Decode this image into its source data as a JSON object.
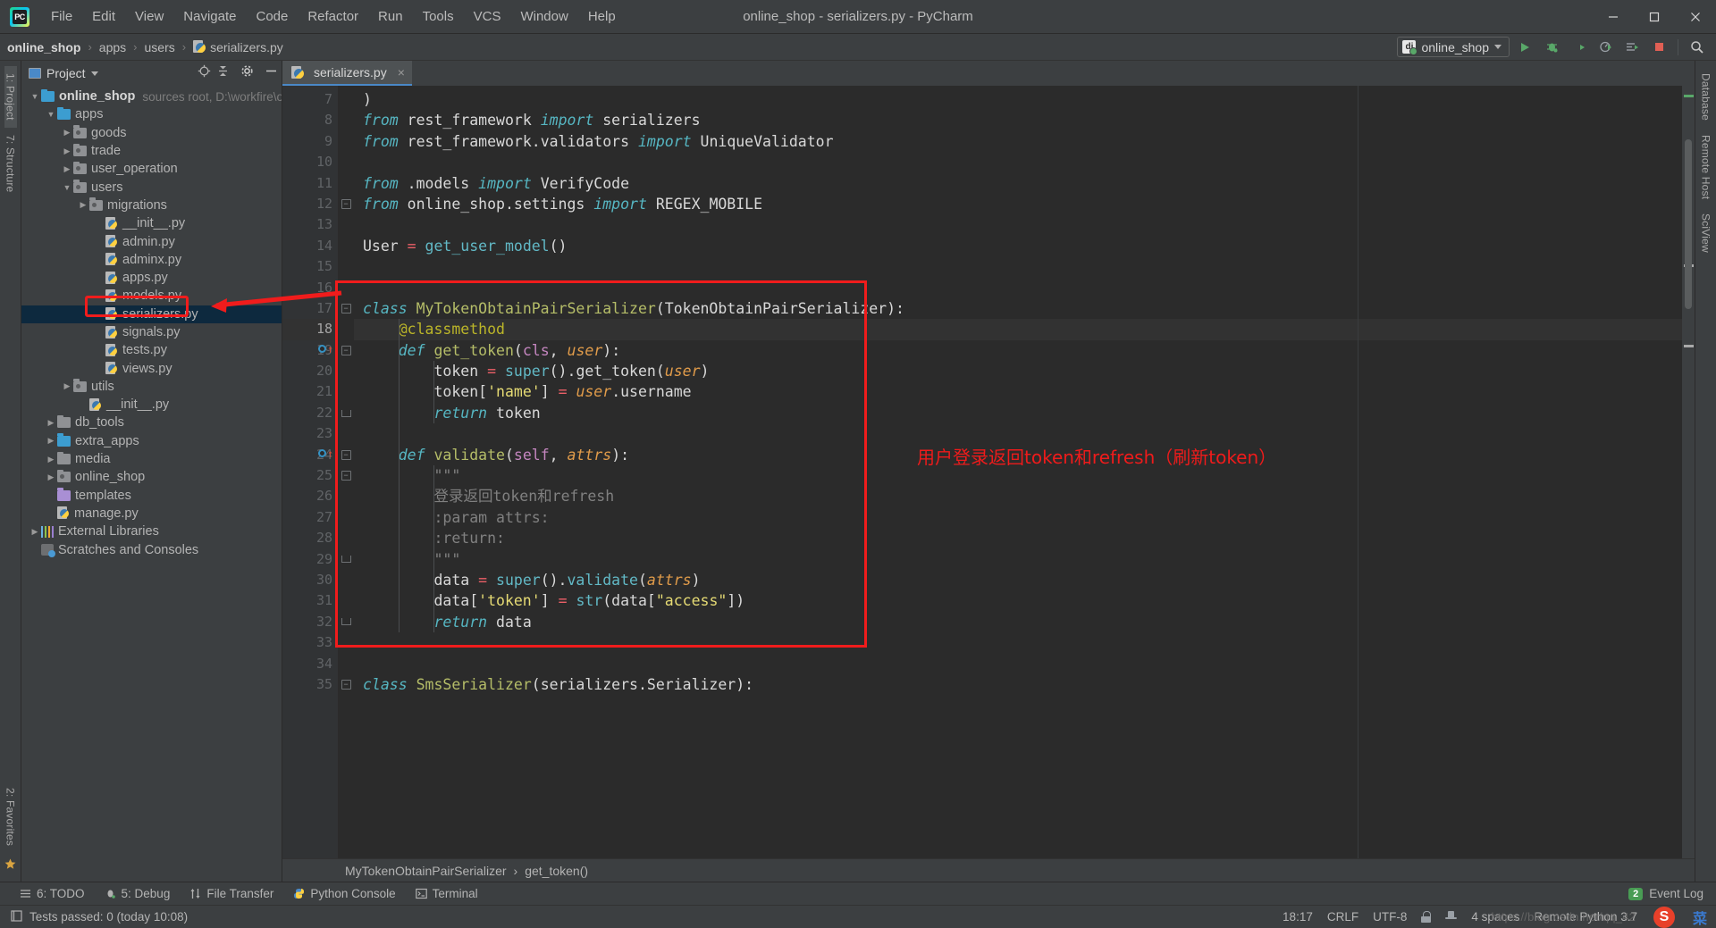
{
  "window": {
    "title": "online_shop - serializers.py - PyCharm",
    "logo_text": "PC",
    "minimize_label": "Minimize",
    "maximize_label": "Maximize",
    "close_label": "Close"
  },
  "menubar": {
    "items": [
      "File",
      "Edit",
      "View",
      "Navigate",
      "Code",
      "Refactor",
      "Run",
      "Tools",
      "VCS",
      "Window",
      "Help"
    ]
  },
  "breadcrumb": {
    "items": [
      "online_shop",
      "apps",
      "users",
      "serializers.py"
    ],
    "separator": "›"
  },
  "toolbar": {
    "run_config": "online_shop",
    "run_config_icon": "django-icon",
    "buttons": [
      {
        "name": "run-button",
        "glyph": "▶"
      },
      {
        "name": "debug-button",
        "glyph": "🐞"
      },
      {
        "name": "coverage-button",
        "glyph": "◑"
      },
      {
        "name": "profile-button",
        "glyph": "◴"
      },
      {
        "name": "attach-button",
        "glyph": "☰"
      },
      {
        "name": "stop-button",
        "glyph": "■"
      },
      {
        "name": "search-everywhere-button",
        "glyph": "🔍"
      }
    ]
  },
  "left_strip": {
    "items": [
      {
        "label": "1: Project",
        "selected": true
      },
      {
        "label": "7: Structure",
        "selected": false
      }
    ],
    "bottom_items": [
      {
        "label": "2: Favorites",
        "selected": false
      }
    ]
  },
  "right_strip": {
    "items": [
      {
        "label": "Database",
        "selected": false
      },
      {
        "label": "Remote Host",
        "selected": false
      },
      {
        "label": "SciView",
        "selected": false
      }
    ]
  },
  "project_panel": {
    "title": "Project",
    "icons": [
      "locate-icon",
      "collapse-all-icon",
      "settings-gear-icon",
      "hide-icon"
    ],
    "tree": [
      {
        "depth": 0,
        "arrow": "down",
        "icon": "folder-source",
        "label": "online_shop",
        "bold": true,
        "note": "sources root,  D:\\workfire\\onl"
      },
      {
        "depth": 1,
        "arrow": "down",
        "icon": "folder-source",
        "label": "apps",
        "bold": false,
        "note": ""
      },
      {
        "depth": 2,
        "arrow": "right",
        "icon": "folder-module",
        "label": "goods",
        "bold": false,
        "note": ""
      },
      {
        "depth": 2,
        "arrow": "right",
        "icon": "folder-module",
        "label": "trade",
        "bold": false,
        "note": ""
      },
      {
        "depth": 2,
        "arrow": "right",
        "icon": "folder-module",
        "label": "user_operation",
        "bold": false,
        "note": ""
      },
      {
        "depth": 2,
        "arrow": "down",
        "icon": "folder-module",
        "label": "users",
        "bold": false,
        "note": ""
      },
      {
        "depth": 3,
        "arrow": "right",
        "icon": "folder-module",
        "label": "migrations",
        "bold": false,
        "note": ""
      },
      {
        "depth": 4,
        "arrow": "none",
        "icon": "python-file",
        "label": "__init__.py",
        "bold": false,
        "note": ""
      },
      {
        "depth": 4,
        "arrow": "none",
        "icon": "python-file",
        "label": "admin.py",
        "bold": false,
        "note": ""
      },
      {
        "depth": 4,
        "arrow": "none",
        "icon": "python-file",
        "label": "adminx.py",
        "bold": false,
        "note": ""
      },
      {
        "depth": 4,
        "arrow": "none",
        "icon": "python-file",
        "label": "apps.py",
        "bold": false,
        "note": ""
      },
      {
        "depth": 4,
        "arrow": "none",
        "icon": "python-file",
        "label": "models.py",
        "bold": false,
        "note": ""
      },
      {
        "depth": 4,
        "arrow": "none",
        "icon": "python-file",
        "label": "serializers.py",
        "bold": false,
        "note": "",
        "selected": true
      },
      {
        "depth": 4,
        "arrow": "none",
        "icon": "python-file",
        "label": "signals.py",
        "bold": false,
        "note": ""
      },
      {
        "depth": 4,
        "arrow": "none",
        "icon": "python-file",
        "label": "tests.py",
        "bold": false,
        "note": ""
      },
      {
        "depth": 4,
        "arrow": "none",
        "icon": "python-file",
        "label": "views.py",
        "bold": false,
        "note": ""
      },
      {
        "depth": 2,
        "arrow": "right",
        "icon": "folder-module",
        "label": "utils",
        "bold": false,
        "note": ""
      },
      {
        "depth": 3,
        "arrow": "none",
        "icon": "python-file",
        "label": "__init__.py",
        "bold": false,
        "note": ""
      },
      {
        "depth": 1,
        "arrow": "right",
        "icon": "folder",
        "label": "db_tools",
        "bold": false,
        "note": ""
      },
      {
        "depth": 1,
        "arrow": "right",
        "icon": "folder-source",
        "label": "extra_apps",
        "bold": false,
        "note": ""
      },
      {
        "depth": 1,
        "arrow": "right",
        "icon": "folder",
        "label": "media",
        "bold": false,
        "note": ""
      },
      {
        "depth": 1,
        "arrow": "right",
        "icon": "folder-module",
        "label": "online_shop",
        "bold": false,
        "note": ""
      },
      {
        "depth": 1,
        "arrow": "none",
        "icon": "folder-template",
        "label": "templates",
        "bold": false,
        "note": ""
      },
      {
        "depth": 1,
        "arrow": "none",
        "icon": "python-file",
        "label": "manage.py",
        "bold": false,
        "note": ""
      },
      {
        "depth": 0,
        "arrow": "right",
        "icon": "external-libraries",
        "label": "External Libraries",
        "bold": false,
        "note": ""
      },
      {
        "depth": 0,
        "arrow": "none",
        "icon": "scratches",
        "label": "Scratches and Consoles",
        "bold": false,
        "note": ""
      }
    ]
  },
  "editor": {
    "tab": {
      "label": "serializers.py",
      "icon": "python-file",
      "close": "×"
    },
    "first_line_number": 7,
    "current_line": 18,
    "lines": [
      {
        "n": 7,
        "tokens": [
          {
            "t": ")",
            "c": "plain"
          }
        ]
      },
      {
        "n": 8,
        "tokens": [
          {
            "t": "from",
            "c": "kwi"
          },
          {
            "t": " rest_framework ",
            "c": "plain"
          },
          {
            "t": "import",
            "c": "kwi"
          },
          {
            "t": " serializers",
            "c": "plain"
          }
        ]
      },
      {
        "n": 9,
        "tokens": [
          {
            "t": "from",
            "c": "kwi"
          },
          {
            "t": " rest_framework.validators ",
            "c": "plain"
          },
          {
            "t": "import",
            "c": "kwi"
          },
          {
            "t": " UniqueValidator",
            "c": "plain"
          }
        ]
      },
      {
        "n": 10,
        "tokens": []
      },
      {
        "n": 11,
        "tokens": [
          {
            "t": "from",
            "c": "kwi"
          },
          {
            "t": " .models ",
            "c": "plain"
          },
          {
            "t": "import",
            "c": "kwi"
          },
          {
            "t": " VerifyCode",
            "c": "plain"
          }
        ]
      },
      {
        "n": 12,
        "tokens": [
          {
            "t": "from",
            "c": "kwi"
          },
          {
            "t": " online_shop.settings ",
            "c": "plain"
          },
          {
            "t": "import",
            "c": "kwi"
          },
          {
            "t": " REGEX_MOBILE",
            "c": "plain"
          }
        ]
      },
      {
        "n": 13,
        "tokens": []
      },
      {
        "n": 14,
        "tokens": [
          {
            "t": "User ",
            "c": "plain"
          },
          {
            "t": "=",
            "c": "op"
          },
          {
            "t": " ",
            "c": "plain"
          },
          {
            "t": "get_user_model",
            "c": "call"
          },
          {
            "t": "()",
            "c": "plain"
          }
        ]
      },
      {
        "n": 15,
        "tokens": []
      },
      {
        "n": 16,
        "tokens": []
      },
      {
        "n": 17,
        "tokens": [
          {
            "t": "class",
            "c": "kwi"
          },
          {
            "t": " ",
            "c": "plain"
          },
          {
            "t": "MyTokenObtainPairSerializer",
            "c": "fn"
          },
          {
            "t": "(",
            "c": "plain"
          },
          {
            "t": "TokenObtainPairSerializer",
            "c": "plain"
          },
          {
            "t": "):",
            "c": "plain"
          }
        ]
      },
      {
        "n": 18,
        "tokens": [
          {
            "t": "    ",
            "c": "plain"
          },
          {
            "t": "@classmethod",
            "c": "dec"
          }
        ]
      },
      {
        "n": 19,
        "tokens": [
          {
            "t": "    ",
            "c": "plain"
          },
          {
            "t": "def",
            "c": "kwi"
          },
          {
            "t": " ",
            "c": "plain"
          },
          {
            "t": "get_token",
            "c": "fn"
          },
          {
            "t": "(",
            "c": "plain"
          },
          {
            "t": "cls",
            "c": "slf"
          },
          {
            "t": ", ",
            "c": "plain"
          },
          {
            "t": "user",
            "c": "par"
          },
          {
            "t": "):",
            "c": "plain"
          }
        ]
      },
      {
        "n": 20,
        "tokens": [
          {
            "t": "        token ",
            "c": "plain"
          },
          {
            "t": "=",
            "c": "op"
          },
          {
            "t": " ",
            "c": "plain"
          },
          {
            "t": "super",
            "c": "call"
          },
          {
            "t": "().",
            "c": "plain"
          },
          {
            "t": "get_token",
            "c": "plain"
          },
          {
            "t": "(",
            "c": "plain"
          },
          {
            "t": "user",
            "c": "par"
          },
          {
            "t": ")",
            "c": "plain"
          }
        ]
      },
      {
        "n": 21,
        "tokens": [
          {
            "t": "        token[",
            "c": "plain"
          },
          {
            "t": "'name'",
            "c": "str"
          },
          {
            "t": "] ",
            "c": "plain"
          },
          {
            "t": "=",
            "c": "op"
          },
          {
            "t": " ",
            "c": "plain"
          },
          {
            "t": "user",
            "c": "par"
          },
          {
            "t": ".username",
            "c": "plain"
          }
        ]
      },
      {
        "n": 22,
        "tokens": [
          {
            "t": "        ",
            "c": "plain"
          },
          {
            "t": "return",
            "c": "kwi"
          },
          {
            "t": " token",
            "c": "plain"
          }
        ]
      },
      {
        "n": 23,
        "tokens": []
      },
      {
        "n": 24,
        "tokens": [
          {
            "t": "    ",
            "c": "plain"
          },
          {
            "t": "def",
            "c": "kwi"
          },
          {
            "t": " ",
            "c": "plain"
          },
          {
            "t": "validate",
            "c": "fn"
          },
          {
            "t": "(",
            "c": "plain"
          },
          {
            "t": "self",
            "c": "slf"
          },
          {
            "t": ", ",
            "c": "plain"
          },
          {
            "t": "attrs",
            "c": "par"
          },
          {
            "t": "):",
            "c": "plain"
          }
        ]
      },
      {
        "n": 25,
        "tokens": [
          {
            "t": "        \"\"\"",
            "c": "doc"
          }
        ]
      },
      {
        "n": 26,
        "tokens": [
          {
            "t": "        登录返回token和refresh",
            "c": "doc"
          }
        ]
      },
      {
        "n": 27,
        "tokens": [
          {
            "t": "        :param attrs:",
            "c": "doc"
          }
        ]
      },
      {
        "n": 28,
        "tokens": [
          {
            "t": "        :return:",
            "c": "doc"
          }
        ]
      },
      {
        "n": 29,
        "tokens": [
          {
            "t": "        \"\"\"",
            "c": "doc"
          }
        ]
      },
      {
        "n": 30,
        "tokens": [
          {
            "t": "        data ",
            "c": "plain"
          },
          {
            "t": "=",
            "c": "op"
          },
          {
            "t": " ",
            "c": "plain"
          },
          {
            "t": "super",
            "c": "call"
          },
          {
            "t": "().",
            "c": "plain"
          },
          {
            "t": "validate",
            "c": "call"
          },
          {
            "t": "(",
            "c": "plain"
          },
          {
            "t": "attrs",
            "c": "par"
          },
          {
            "t": ")",
            "c": "plain"
          }
        ]
      },
      {
        "n": 31,
        "tokens": [
          {
            "t": "        data[",
            "c": "plain"
          },
          {
            "t": "'token'",
            "c": "str"
          },
          {
            "t": "] ",
            "c": "plain"
          },
          {
            "t": "=",
            "c": "op"
          },
          {
            "t": " ",
            "c": "plain"
          },
          {
            "t": "str",
            "c": "call"
          },
          {
            "t": "(data[",
            "c": "plain"
          },
          {
            "t": "\"access\"",
            "c": "str"
          },
          {
            "t": "])",
            "c": "plain"
          }
        ]
      },
      {
        "n": 32,
        "tokens": [
          {
            "t": "        ",
            "c": "plain"
          },
          {
            "t": "return",
            "c": "kwi"
          },
          {
            "t": " data",
            "c": "plain"
          }
        ]
      },
      {
        "n": 33,
        "tokens": []
      },
      {
        "n": 34,
        "tokens": []
      },
      {
        "n": 35,
        "tokens": [
          {
            "t": "class",
            "c": "kwi"
          },
          {
            "t": " ",
            "c": "plain"
          },
          {
            "t": "SmsSerializer",
            "c": "fn"
          },
          {
            "t": "(",
            "c": "plain"
          },
          {
            "t": "serializers.Serializer",
            "c": "plain"
          },
          {
            "t": "):",
            "c": "plain"
          }
        ]
      }
    ],
    "breadcrumb": [
      "MyTokenObtainPairSerializer",
      "get_token()"
    ],
    "breadcrumb_separator": "›"
  },
  "annotation": {
    "text": "用户登录返回token和refresh（刷新token）",
    "color": "#ef1b1b"
  },
  "tool_windows": {
    "items": [
      {
        "label": "6: TODO",
        "icon": "todo-icon"
      },
      {
        "label": "5: Debug",
        "icon": "debug-icon"
      },
      {
        "label": "File Transfer",
        "icon": "transfer-icon"
      },
      {
        "label": "Python Console",
        "icon": "python-icon"
      },
      {
        "label": "Terminal",
        "icon": "terminal-icon"
      }
    ],
    "event_log": {
      "label": "Event Log",
      "badge": "2"
    }
  },
  "statusbar": {
    "message": "Tests passed: 0 (today 10:08)",
    "time": "18:17",
    "line_sep": "CRLF",
    "encoding": "UTF-8",
    "indent": "4 spaces",
    "interpreter": "Remote Python 3.7",
    "watermark": "https://blog.csdn.net/qq_42",
    "ime_char": "菜",
    "ime_logo": "S"
  }
}
